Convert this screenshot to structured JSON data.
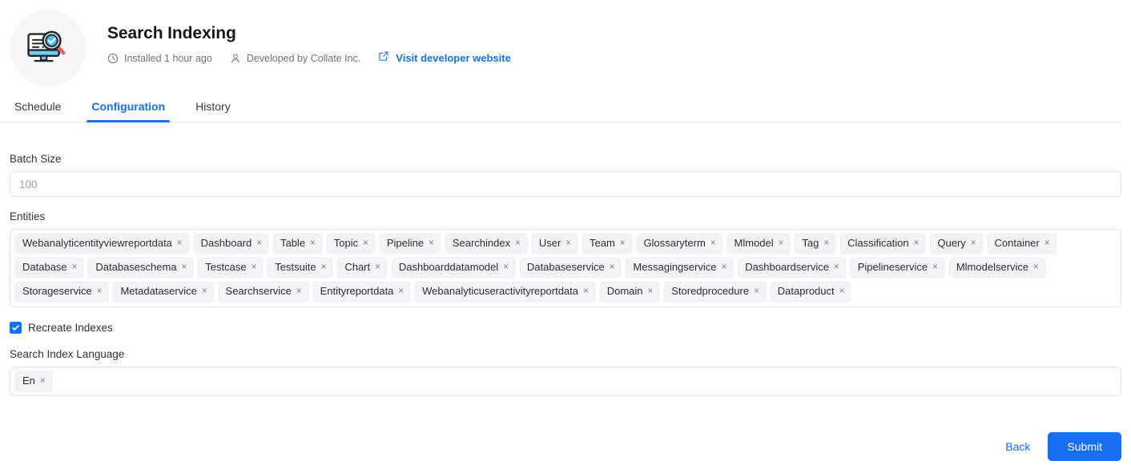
{
  "header": {
    "logo_icon": "search-indexing-monitor-magnifier-icon",
    "title": "Search Indexing",
    "installed_icon": "clock-icon",
    "installed_text": "Installed 1 hour ago",
    "developer_icon": "user-icon",
    "developer_text": "Developed by Collate Inc.",
    "website_icon": "external-link-icon",
    "website_link_text": "Visit developer website"
  },
  "tabs": [
    {
      "label": "Schedule",
      "active": false
    },
    {
      "label": "Configuration",
      "active": true
    },
    {
      "label": "History",
      "active": false
    }
  ],
  "form": {
    "batch_size": {
      "label": "Batch Size",
      "value": "",
      "placeholder": "100"
    },
    "entities": {
      "label": "Entities",
      "tags": [
        "Webanalyticentityviewreportdata",
        "Dashboard",
        "Table",
        "Topic",
        "Pipeline",
        "Searchindex",
        "User",
        "Team",
        "Glossaryterm",
        "Mlmodel",
        "Tag",
        "Classification",
        "Query",
        "Container",
        "Database",
        "Databaseschema",
        "Testcase",
        "Testsuite",
        "Chart",
        "Dashboarddatamodel",
        "Databaseservice",
        "Messagingservice",
        "Dashboardservice",
        "Pipelineservice",
        "Mlmodelservice",
        "Storageservice",
        "Metadataservice",
        "Searchservice",
        "Entityreportdata",
        "Webanalyticuseractivityreportdata",
        "Domain",
        "Storedprocedure",
        "Dataproduct"
      ],
      "remove_glyph": "×"
    },
    "recreate_indexes": {
      "label": "Recreate Indexes",
      "checked": true,
      "check_icon": "checkmark-icon"
    },
    "search_index_language": {
      "label": "Search Index Language",
      "tags": [
        "En"
      ],
      "remove_glyph": "×"
    }
  },
  "footer": {
    "back_label": "Back",
    "submit_label": "Submit"
  },
  "colors": {
    "accent": "#1570ef",
    "text": "#2b2f36",
    "muted": "#6b7280",
    "tag_bg": "#f4f4f6",
    "border": "#e3e4e8"
  }
}
